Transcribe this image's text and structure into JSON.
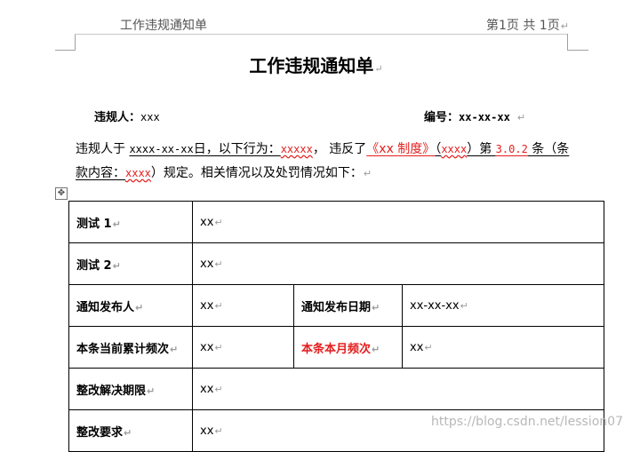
{
  "header": {
    "left_text": "工作违规通知单",
    "right_text": "第1页   共  1页"
  },
  "title": "工作违规通知单",
  "meta": {
    "violator_label": "违规人：",
    "violator_value": "xxx",
    "number_label": "编号：",
    "number_value": "xx-xx-xx"
  },
  "paragraph": {
    "p1": "违规人于 ",
    "date": "xxxx-xx-xx",
    "p2": "日，以下行为：",
    "behavior": "xxxxx",
    "p3": "，  违反了",
    "rule_link": "《xx 制度》",
    "p4": "（",
    "rule_code": "xxxx",
    "p5": "）第 ",
    "clause": "3.0.2",
    "p6": " 条（条",
    "p7": "款内容：",
    "clause_content": "xxxx",
    "p8": "）规定。相关情况以及处罚情况如下："
  },
  "table": {
    "rows": [
      {
        "label": "测试 1",
        "value": "xx"
      },
      {
        "label": "测试 2",
        "value": "xx"
      },
      {
        "label": "通知发布人",
        "value": "xx",
        "label2": "通知发布日期",
        "value2": "xx-xx-xx"
      },
      {
        "label": "本条当前累计频次",
        "value": "xx",
        "label2": "本条本月频次",
        "value2": "xx"
      },
      {
        "label": "整改解决期限",
        "value": "xx"
      },
      {
        "label": "整改要求",
        "value": "xx"
      }
    ]
  },
  "watermark": "https://blog.csdn.net/lession07",
  "colors": {
    "red_text": "#e41e1e",
    "border": "#000000"
  },
  "icons": {
    "return_mark": "↵",
    "table_move": "✥"
  }
}
